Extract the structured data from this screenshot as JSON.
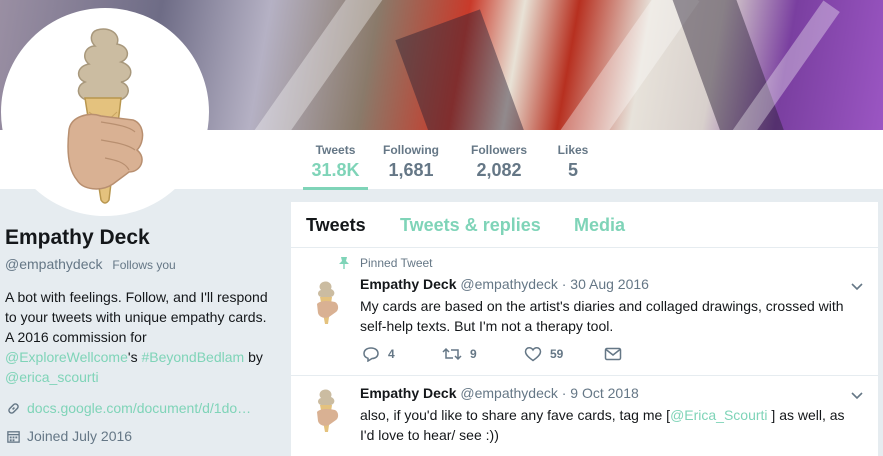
{
  "profile": {
    "name": "Empathy Deck",
    "handle": "@empathydeck",
    "follows_you": "Follows you",
    "bio_text_1": "A bot with feelings. Follow, and I'll respond to your tweets with unique empathy cards. A 2016 commission for ",
    "bio_link_1": "@ExploreWellcome",
    "bio_text_2": "'s ",
    "bio_link_2": "#BeyondBedlam",
    "bio_text_3": " by ",
    "bio_link_3": "@erica_scourti",
    "website": "docs.google.com/document/d/1do…",
    "joined": "Joined July 2016"
  },
  "stats": [
    {
      "label": "Tweets",
      "value": "31.8K"
    },
    {
      "label": "Following",
      "value": "1,681"
    },
    {
      "label": "Followers",
      "value": "2,082"
    },
    {
      "label": "Likes",
      "value": "5"
    }
  ],
  "tabs": [
    "Tweets",
    "Tweets & replies",
    "Media"
  ],
  "tweets": [
    {
      "pinned_label": "Pinned Tweet",
      "name": "Empathy Deck",
      "handle": "@empathydeck",
      "date": "· 30 Aug 2016",
      "text": "My cards are based on the artist's diaries and collaged drawings, crossed with self-help texts. But I'm not a therapy tool.",
      "replies": "4",
      "retweets": "9",
      "likes": "59"
    },
    {
      "name": "Empathy Deck",
      "handle": "@empathydeck",
      "date": "· 9 Oct 2018",
      "text_1": "also, if you'd like to share any fave cards, tag me [",
      "text_link": "@Erica_Scourti",
      "text_2": " ] as well, as I'd love to hear/ see :))"
    }
  ],
  "colors": {
    "accent": "#7fd4b8",
    "muted": "#657786",
    "text": "#14171a",
    "bg": "#e6ecf0"
  },
  "icons": [
    "pin-icon",
    "link-icon",
    "calendar-icon",
    "reply-icon",
    "retweet-icon",
    "like-icon",
    "dm-icon",
    "chevron-down-icon"
  ]
}
